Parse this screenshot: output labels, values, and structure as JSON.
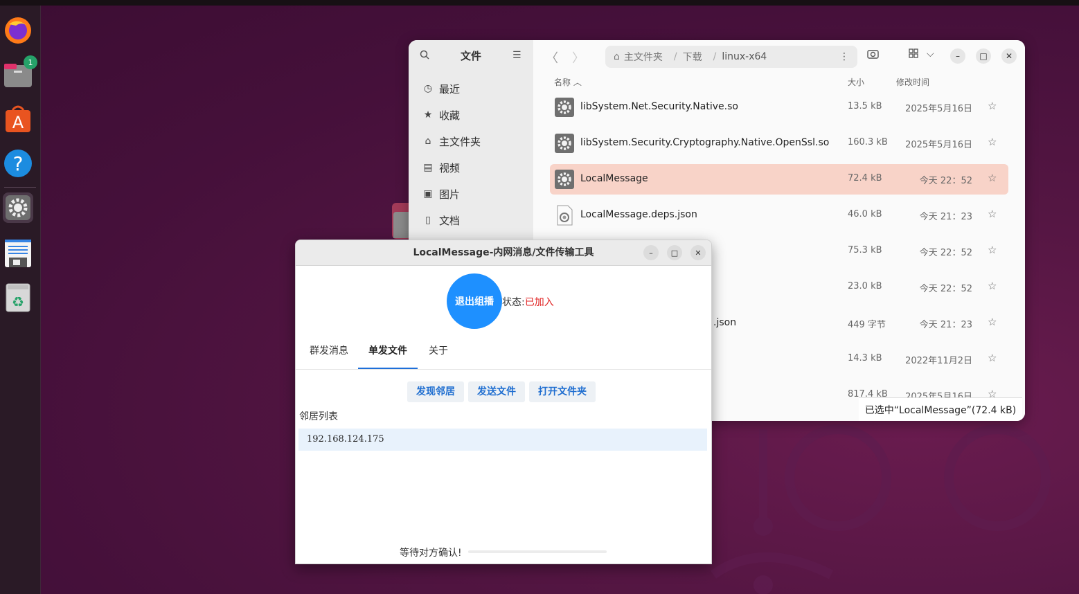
{
  "dock": {
    "apps": [
      {
        "name": "firefox-icon",
        "badge": ""
      },
      {
        "name": "files-icon",
        "badge": "1"
      },
      {
        "name": "app-center-icon",
        "badge": ""
      },
      {
        "name": "help-icon",
        "badge": ""
      },
      {
        "name": "settings-icon",
        "badge": ""
      },
      {
        "name": "text-editor-icon",
        "badge": ""
      },
      {
        "name": "trash-icon",
        "badge": ""
      }
    ]
  },
  "file_manager": {
    "sidebar_title": "文件",
    "sidebar_items": [
      {
        "label": "最近",
        "icon": "clock-icon"
      },
      {
        "label": "收藏",
        "icon": "star-icon"
      },
      {
        "label": "主文件夹",
        "icon": "home-icon"
      },
      {
        "label": "视频",
        "icon": "video-icon"
      },
      {
        "label": "图片",
        "icon": "image-icon"
      },
      {
        "label": "文档",
        "icon": "document-icon"
      }
    ],
    "path": [
      "主文件夹",
      "下载",
      "linux-x64"
    ],
    "columns": {
      "name": "名称",
      "size": "大小",
      "modified": "修改时间"
    },
    "files": [
      {
        "name": "libSystem.Net.Security.Native.so",
        "size": "13.5 kB",
        "date": "2025年5月16日",
        "type": "executable",
        "selected": false
      },
      {
        "name": "libSystem.Security.Cryptography.Native.OpenSsl.so",
        "size": "160.3 kB",
        "date": "2025年5月16日",
        "type": "executable",
        "selected": false
      },
      {
        "name": "LocalMessage",
        "size": "72.4 kB",
        "date": "今天 22：52",
        "type": "executable",
        "selected": true
      },
      {
        "name": "LocalMessage.deps.json",
        "size": "46.0 kB",
        "date": "今天 21：23",
        "type": "json",
        "selected": false
      },
      {
        "name": "",
        "size": "75.3 kB",
        "date": "今天 22：52",
        "type": "hidden",
        "selected": false
      },
      {
        "name": "",
        "size": "23.0 kB",
        "date": "今天 22：52",
        "type": "hidden",
        "selected": false
      },
      {
        "name": ".json",
        "size": "449 字节",
        "date": "今天 21：23",
        "type": "hidden",
        "selected": false
      },
      {
        "name": "",
        "size": "14.3 kB",
        "date": "2022年11月2日",
        "type": "hidden",
        "selected": false
      },
      {
        "name": "",
        "size": "817.4 kB",
        "date": "2025年5月16日",
        "type": "hidden",
        "selected": false
      }
    ],
    "status": "已选中“LocalMessage”(72.4 kB)"
  },
  "local_message": {
    "title": "LocalMessage-内网消息/文件传输工具",
    "leave_button": "退出组播",
    "status_label": "状态:",
    "status_value": "已加入",
    "tabs": [
      "群发消息",
      "单发文件",
      "关于"
    ],
    "active_tab": 1,
    "actions": {
      "discover": "发现邻居",
      "send": "发送文件",
      "open_folder": "打开文件夹"
    },
    "neighbor_label": "邻居列表",
    "neighbors": [
      "192.168.124.175"
    ],
    "wait_text": "等待对方确认!",
    "progress": 0
  },
  "colors": {
    "accent": "#1e90ff",
    "status_red": "#e02020",
    "selection": "#f8d3c8"
  }
}
